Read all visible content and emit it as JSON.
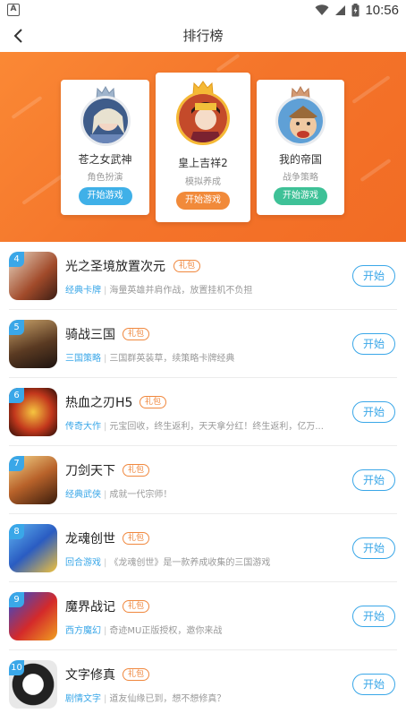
{
  "status": {
    "time": "10:56"
  },
  "header": {
    "title": "排行榜"
  },
  "colors": {
    "accent": "#3aa7e8",
    "banner": "#f4742a",
    "gift": "#f0883e"
  },
  "top3": [
    {
      "rank": 2,
      "name": "苍之女武神",
      "genre": "角色扮演",
      "button": "开始游戏",
      "button_color": "#3fb0e8"
    },
    {
      "rank": 1,
      "name": "皇上吉祥2",
      "genre": "模拟养成",
      "button": "开始游戏",
      "button_color": "#f18a3a"
    },
    {
      "rank": 3,
      "name": "我的帝国",
      "genre": "战争策略",
      "button": "开始游戏",
      "button_color": "#3ec197"
    }
  ],
  "games": [
    {
      "rank": "4",
      "name": "光之圣境放置次元",
      "gift": "礼包",
      "tag": "经典卡牌",
      "desc": "海量英雄并肩作战，放置挂机不负担",
      "button": "开始"
    },
    {
      "rank": "5",
      "name": "骑战三国",
      "gift": "礼包",
      "tag": "三国策略",
      "desc": "三国群英装草，续策略卡牌经典",
      "button": "开始"
    },
    {
      "rank": "6",
      "name": "热血之刃H5",
      "gift": "礼包",
      "tag": "传奇大作",
      "desc": "元宝回收，终生返利，天天拿分红！终生返利，亿万...",
      "button": "开始"
    },
    {
      "rank": "7",
      "name": "刀剑天下",
      "gift": "礼包",
      "tag": "经典武侠",
      "desc": "成就一代宗师！",
      "button": "开始"
    },
    {
      "rank": "8",
      "name": "龙魂创世",
      "gift": "礼包",
      "tag": "回合游戏",
      "desc": "《龙魂创世》是一款养成收集的三国游戏",
      "button": "开始"
    },
    {
      "rank": "9",
      "name": "魔界战记",
      "gift": "礼包",
      "tag": "西方魔幻",
      "desc": "奇迹MU正版授权，邀你来战",
      "button": "开始"
    },
    {
      "rank": "10",
      "name": "文字修真",
      "gift": "礼包",
      "tag": "剧情文字",
      "desc": "道友仙缘已到，想不想修真？",
      "button": "开始"
    }
  ]
}
